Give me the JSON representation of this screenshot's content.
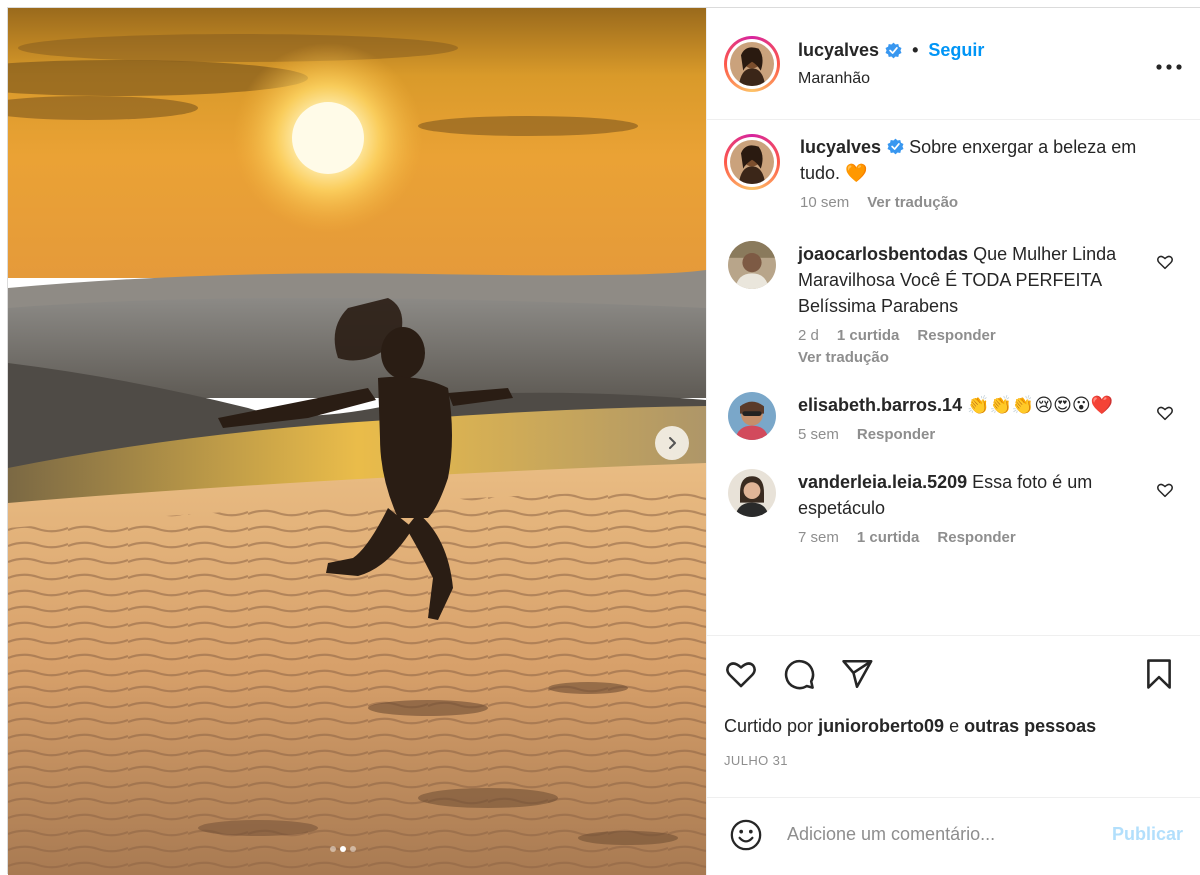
{
  "post": {
    "username": "lucyalves",
    "follow_label": "Seguir",
    "separator": "•",
    "location": "Maranhão",
    "more_icon": "more-horizontal-icon",
    "photo": {
      "alt": "Woman jumping on sand dunes at sunset in Lençóis Maranhenses",
      "slide_count": 3,
      "active_slide": 2
    }
  },
  "caption": {
    "username": "lucyalves",
    "text": "Sobre enxergar a beleza em tudo. 🧡",
    "time": "10 sem",
    "translate": "Ver tradução"
  },
  "comments": [
    {
      "username": "joaocarlosbentodas",
      "text": "Que Mulher Linda Maravilhosa Você É TODA PERFEITA Belíssima Parabens",
      "time": "2 d",
      "likes": "1 curtida",
      "reply": "Responder",
      "translate": "Ver tradução"
    },
    {
      "username": "elisabeth.barros.14",
      "text": "👏👏👏😢😍😮❤️",
      "time": "5 sem",
      "reply": "Responder"
    },
    {
      "username": "vanderleia.leia.5209",
      "text": "Essa foto é um espetáculo",
      "time": "7 sem",
      "likes": "1 curtida",
      "reply": "Responder"
    }
  ],
  "actions": {
    "liked_prefix": "Curtido por",
    "liked_user": "junioroberto09",
    "liked_conj": "e",
    "liked_others": "outras pessoas",
    "date": "JULHO 31"
  },
  "composer": {
    "placeholder": "Adicione um comentário...",
    "publish_label": "Publicar"
  },
  "colors": {
    "accent": "#0095f6",
    "publish_disabled": "#b2dffc",
    "verified": "#3897f0"
  }
}
